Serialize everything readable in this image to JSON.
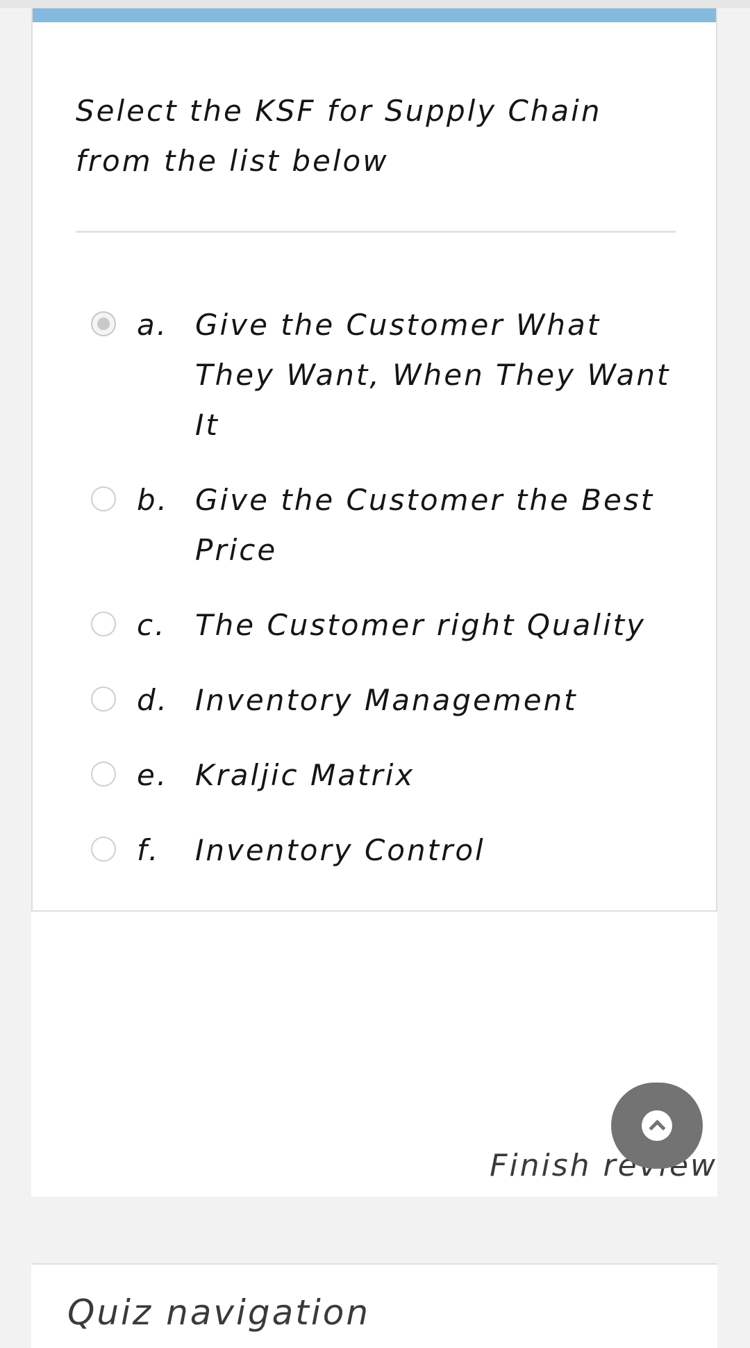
{
  "question": {
    "text": "Select the KSF for Supply Chain from the list below",
    "answers": [
      {
        "letter": "a.",
        "text": "Give the Customer What They Want, When They Want It",
        "selected": true
      },
      {
        "letter": "b.",
        "text": "Give the Customer the Best Price",
        "selected": false
      },
      {
        "letter": "c.",
        "text": "The Customer right Quality",
        "selected": false
      },
      {
        "letter": "d.",
        "text": "Inventory Management",
        "selected": false
      },
      {
        "letter": "e.",
        "text": "Kraljic Matrix",
        "selected": false
      },
      {
        "letter": "f.",
        "text": "Inventory Control",
        "selected": false
      }
    ]
  },
  "footer": {
    "finish_review_label": "Finish review"
  },
  "scroll_top": {
    "icon": "chevron-up-icon"
  },
  "quiz_navigation": {
    "title": "Quiz navigation"
  },
  "colors": {
    "accent": "#86b9de",
    "background": "#f2f2f2",
    "scroll_button": "#737373"
  }
}
